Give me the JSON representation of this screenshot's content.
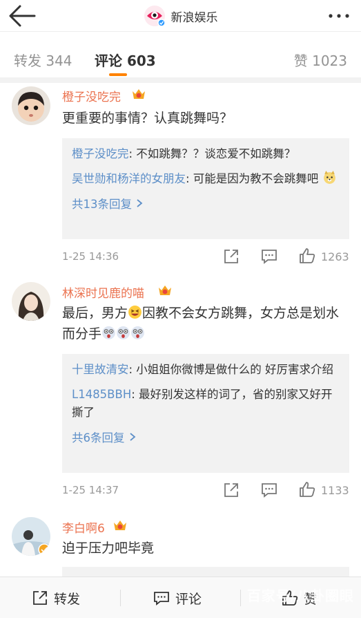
{
  "header": {
    "title": "新浪娱乐",
    "back_icon": "arrow-left-icon",
    "more_icon": "more-dots-icon"
  },
  "tabs": [
    {
      "label": "转发",
      "count": "344"
    },
    {
      "label": "评论",
      "count": "603",
      "active": true
    },
    {
      "label": "赞",
      "count": "1023"
    }
  ],
  "comments": [
    {
      "user": "橙子没吃完",
      "text": "更重要的事情？认真跳舞吗？",
      "replies": [
        {
          "user": "橙子没吃完",
          "text": ": 不如跳舞？？谈恋爱不如跳舞？"
        },
        {
          "user": "吴世勋和杨洋的女朋友",
          "text": ": 可能是因为教不会跳舞吧"
        }
      ],
      "more": "共13条回复",
      "time": "1-25 14:36",
      "likes": "1263"
    },
    {
      "user": "林深时见鹿的喵",
      "text_part1": "最后，男方",
      "text_part2": "因教不会女方跳舞，女方总是划水而分手",
      "replies": [
        {
          "user": "十里故清安",
          "text": ": 小姐姐你微博是做什么的 好厉害求介绍"
        },
        {
          "user": "L1485BBH",
          "text": ": 最好别发这样的词了，省的别家又好开撕了"
        }
      ],
      "more": "共6条回复",
      "time": "1-25 14:37",
      "likes": "1133"
    },
    {
      "user": "李白啊6",
      "text": "迫于压力吧毕竟"
    }
  ],
  "bottom_bar": {
    "repost": "转发",
    "comment": "评论",
    "like": "赞"
  },
  "watermark": "百家号/八卦圈眼",
  "colors": {
    "accent": "#ff8200",
    "username": "#eb7350",
    "reply_user": "#5d8fc8",
    "meta": "#999999"
  }
}
